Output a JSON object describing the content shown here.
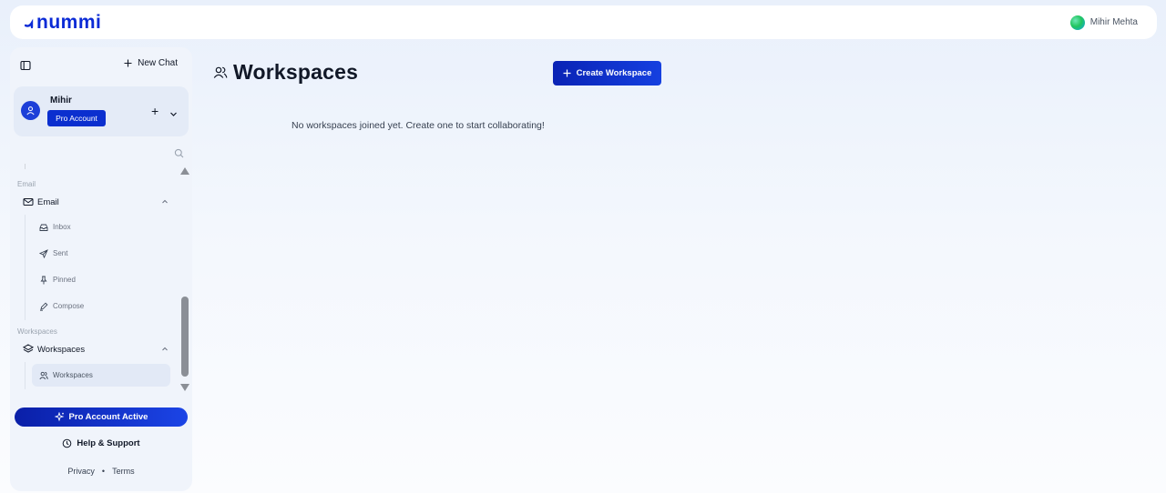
{
  "header": {
    "brand": "nummi",
    "user_name": "Mihir Mehta"
  },
  "sidebar": {
    "new_chat_label": "New Chat",
    "account": {
      "name": "Mihir",
      "badge": "Pro Account"
    },
    "sections": [
      {
        "label": "Email",
        "group": "Email",
        "items": [
          "Inbox",
          "Sent",
          "Pinned",
          "Compose"
        ]
      },
      {
        "label": "Workspaces",
        "group": "Workspaces",
        "items": [
          "Workspaces"
        ]
      }
    ],
    "pro_active_label": "Pro Account Active",
    "help_label": "Help & Support",
    "privacy_label": "Privacy",
    "separator": "•",
    "terms_label": "Terms"
  },
  "main": {
    "title": "Workspaces",
    "create_button": "Create Workspace",
    "empty_message": "No workspaces joined yet. Create one to start collaborating!"
  },
  "colors": {
    "brand": "#0b2bd6",
    "primary_button": "#1540e0",
    "sidebar_bg": "#f0f4fb"
  }
}
